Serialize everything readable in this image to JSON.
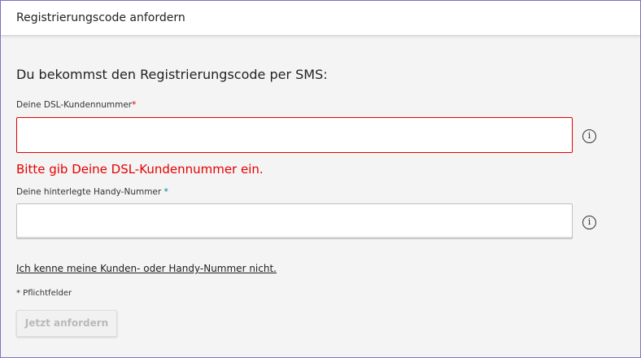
{
  "header": {
    "title": "Registrierungscode anfordern"
  },
  "form": {
    "intro": "Du bekommst den Registrierungscode per SMS:",
    "fields": [
      {
        "label": "Deine DSL-Kundennummer",
        "required_marker": "*",
        "value": "",
        "placeholder": "",
        "info_icon": "info-icon",
        "error": "Bitte gib Deine DSL-Kundennummer ein."
      },
      {
        "label": "Deine hinterlegte Handy-Nummer",
        "required_marker": "*",
        "value": "",
        "placeholder": "",
        "info_icon": "info-icon"
      }
    ],
    "forgot_link": "Ich kenne meine Kunden- oder Handy-Nummer nicht.",
    "required_note": "* Pflichtfelder",
    "submit_label": "Jetzt anfordern",
    "info_glyph": "i"
  },
  "colors": {
    "error": "#e60000",
    "required_secondary": "#007c92",
    "frame_border": "#7d74c9",
    "button_disabled_text": "#b9b9b9"
  }
}
